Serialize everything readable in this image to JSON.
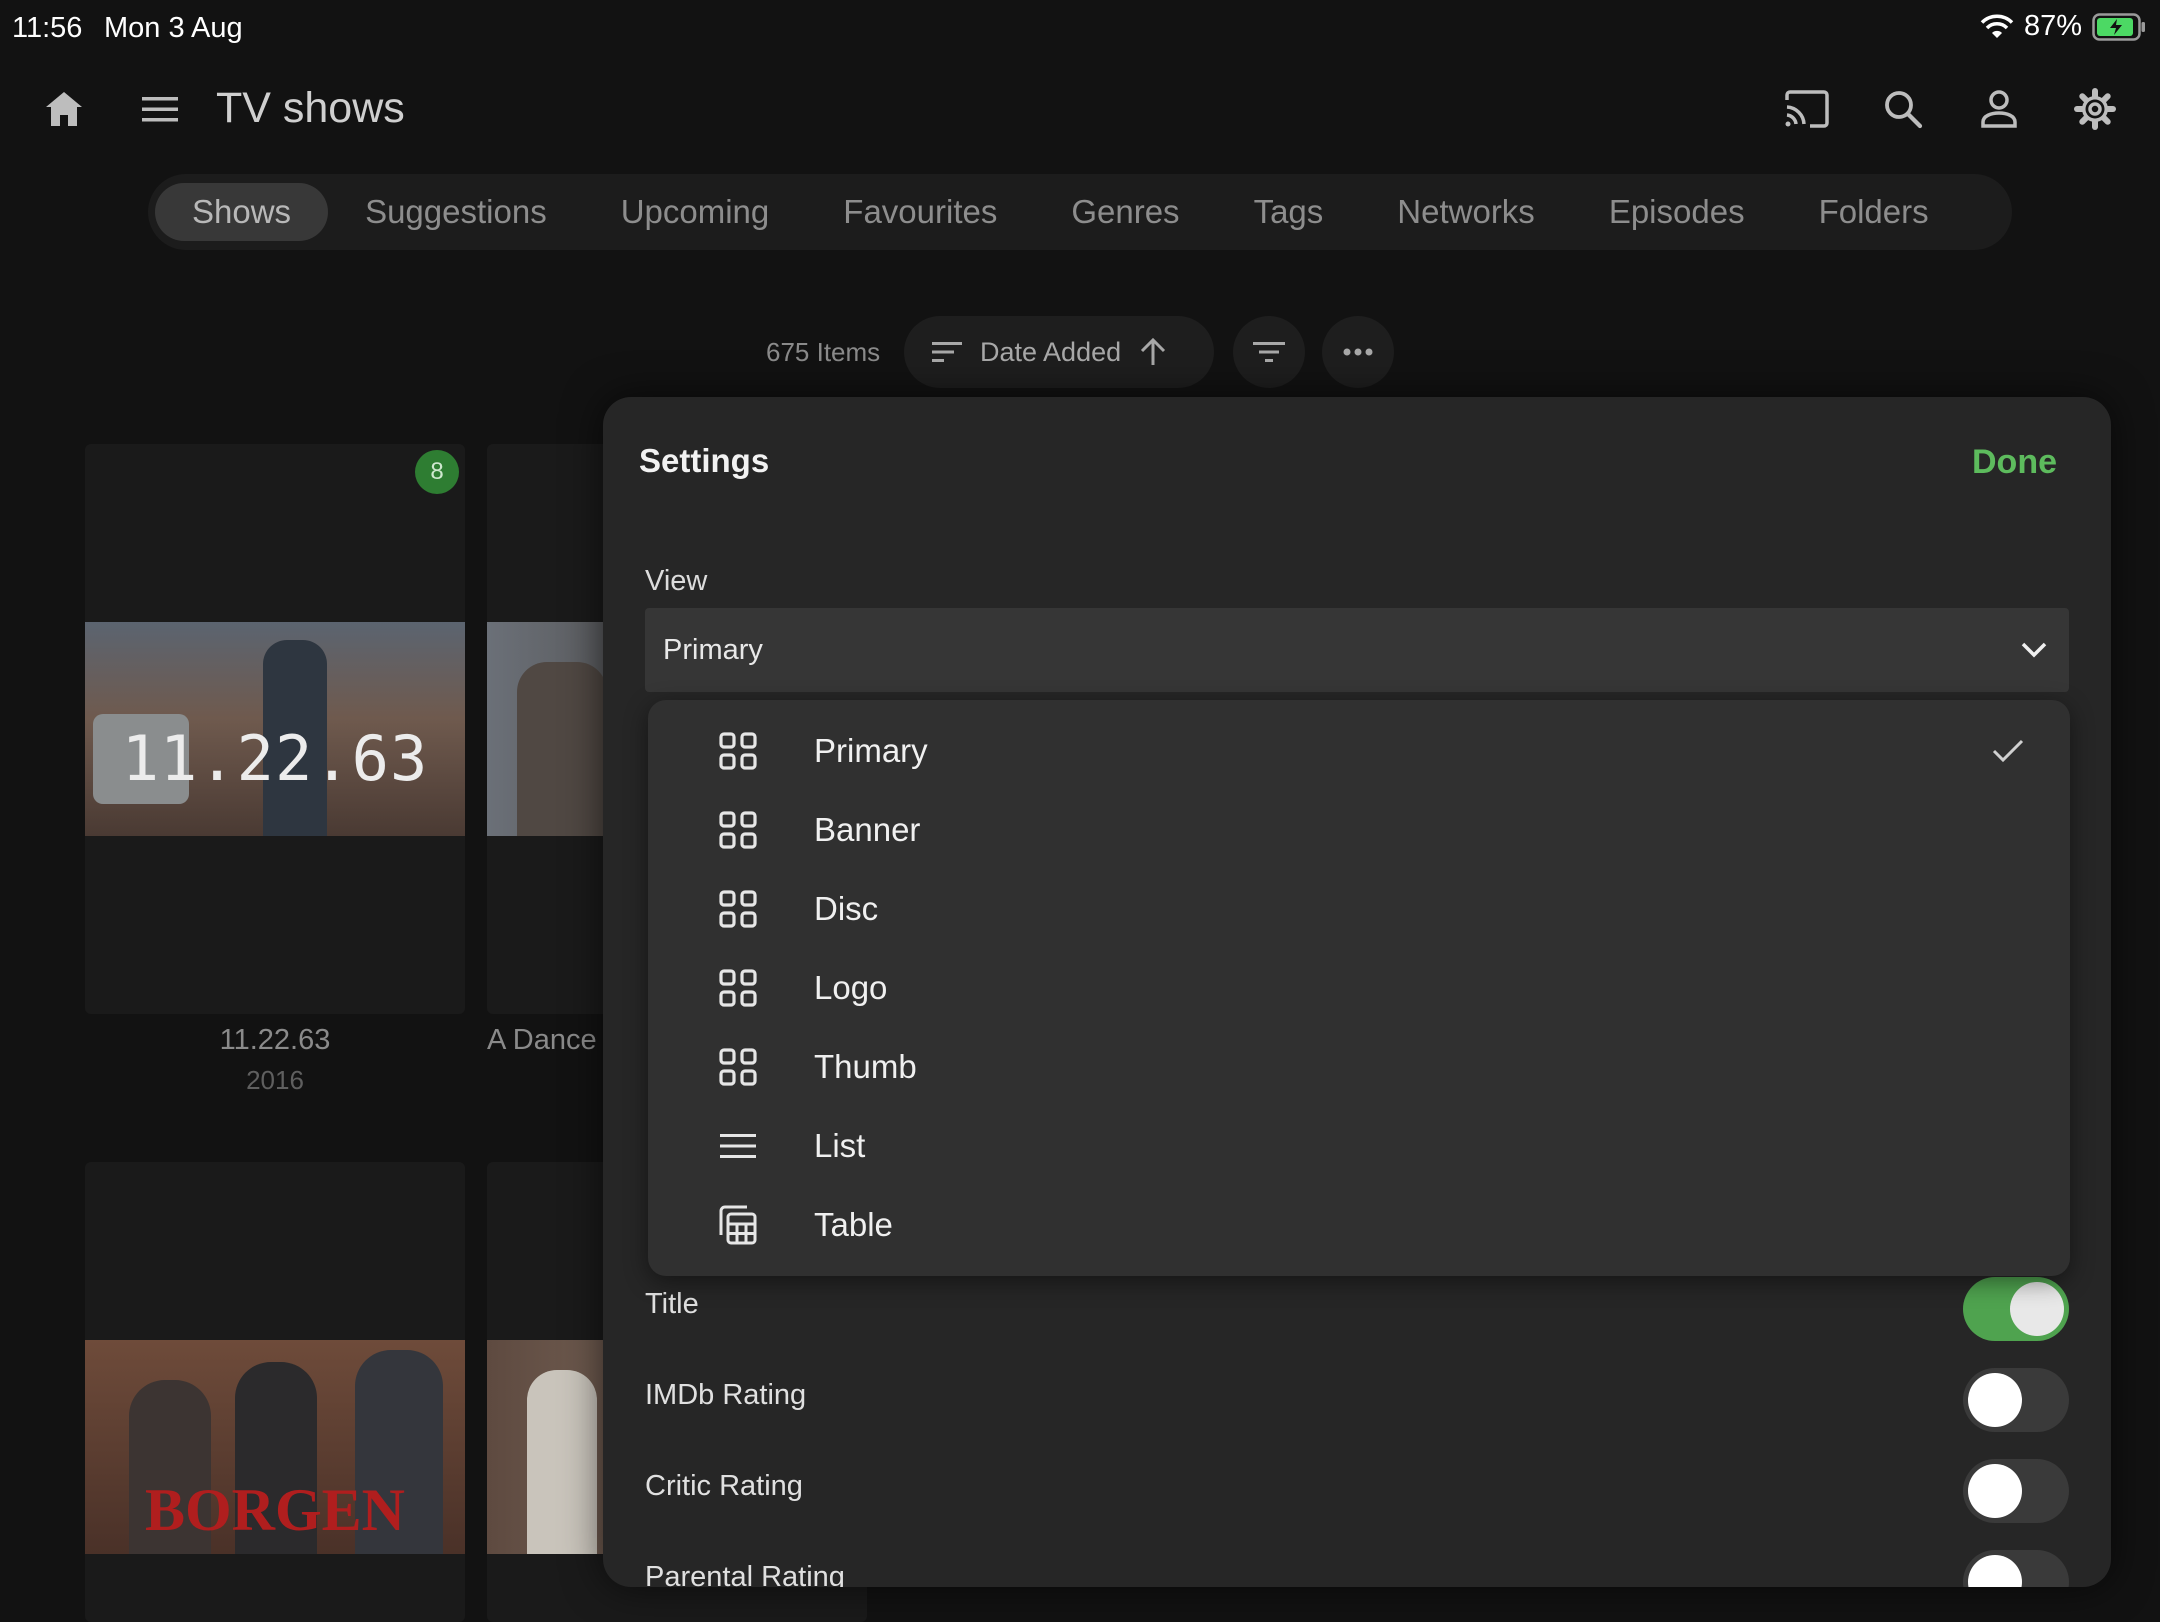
{
  "status_bar": {
    "time": "11:56",
    "date": "Mon 3 Aug",
    "battery": "87%"
  },
  "header": {
    "title": "TV shows",
    "icons": [
      "home-icon",
      "menu-icon",
      "cast-icon",
      "search-icon",
      "user-icon",
      "settings-icon"
    ]
  },
  "tabs": [
    {
      "label": "Shows",
      "active": true
    },
    {
      "label": "Suggestions"
    },
    {
      "label": "Upcoming"
    },
    {
      "label": "Favourites"
    },
    {
      "label": "Genres"
    },
    {
      "label": "Tags"
    },
    {
      "label": "Networks"
    },
    {
      "label": "Episodes"
    },
    {
      "label": "Folders"
    }
  ],
  "toolbar": {
    "items_count": "675 Items",
    "sort_label": "Date Added"
  },
  "grid": {
    "cards": [
      {
        "title": "11.22.63",
        "year": "2016",
        "badge": "8",
        "poster_text": "11.22.63"
      },
      {
        "title": "A Dance"
      },
      {
        "poster_text": "BORGEN"
      },
      {}
    ]
  },
  "settings": {
    "title": "Settings",
    "done_label": "Done",
    "view_label": "View",
    "view_selected": "Primary",
    "view_options": [
      {
        "label": "Primary",
        "icon": "grid-icon",
        "checked": true
      },
      {
        "label": "Banner",
        "icon": "grid-icon"
      },
      {
        "label": "Disc",
        "icon": "grid-icon"
      },
      {
        "label": "Logo",
        "icon": "grid-icon"
      },
      {
        "label": "Thumb",
        "icon": "grid-icon"
      },
      {
        "label": "List",
        "icon": "list-icon"
      },
      {
        "label": "Table",
        "icon": "table-icon"
      }
    ],
    "toggles": [
      {
        "label": "Title",
        "on": true
      },
      {
        "label": "IMDb Rating",
        "on": false
      },
      {
        "label": "Critic Rating",
        "on": false
      },
      {
        "label": "Parental Rating",
        "on": false
      }
    ]
  },
  "colors": {
    "accent": "#5dbb5d",
    "toggle_on": "#4fa34f",
    "background": "#121212",
    "panel": "#262626"
  }
}
